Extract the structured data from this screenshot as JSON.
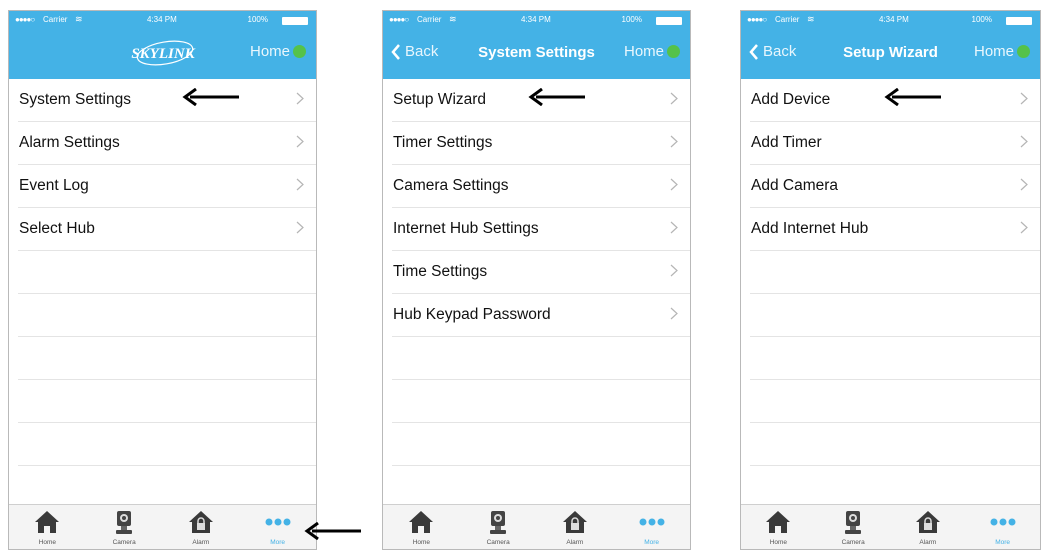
{
  "status": {
    "carrier": "Carrier",
    "time": "4:34 PM",
    "battery": "100%"
  },
  "screens": [
    {
      "logo": "SKYLINK",
      "home_label": "Home",
      "items": [
        "System Settings",
        "Alarm Settings",
        "Event Log",
        "Select Hub"
      ]
    },
    {
      "back_label": "Back",
      "title": "System Settings",
      "home_label": "Home",
      "items": [
        "Setup Wizard",
        "Timer Settings",
        "Camera Settings",
        "Internet Hub Settings",
        "Time Settings",
        "Hub Keypad Password"
      ]
    },
    {
      "back_label": "Back",
      "title": "Setup Wizard",
      "home_label": "Home",
      "items": [
        "Add Device",
        "Add Timer",
        "Add Camera",
        "Add Internet Hub"
      ]
    }
  ],
  "tabbar": {
    "home": "Home",
    "camera": "Camera",
    "alarm": "Alarm",
    "more": "More",
    "active": "More"
  },
  "colors": {
    "header": "#44b2e6",
    "online_dot": "#55c24a",
    "accent": "#44b2e6"
  }
}
